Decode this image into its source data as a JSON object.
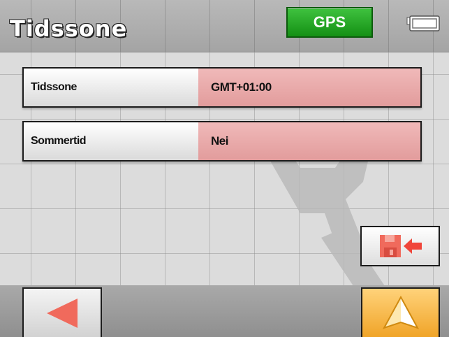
{
  "header": {
    "title": "Tidssone",
    "gps_label": "GPS",
    "gps_color": "#1ca81c"
  },
  "settings": [
    {
      "label": "Tidssone",
      "value": "GMT+01:00"
    },
    {
      "label": "Sommertid",
      "value": "Nei"
    }
  ],
  "icons": {
    "battery": "battery-icon",
    "save": "save-icon",
    "back": "back-arrow-icon",
    "navigate": "navigation-arrow-icon",
    "watermark": "wrench-icon"
  },
  "colors": {
    "value_cell": "#e8a8a8",
    "accent_red": "#f06a5c",
    "nav_button": "#f5b640"
  }
}
